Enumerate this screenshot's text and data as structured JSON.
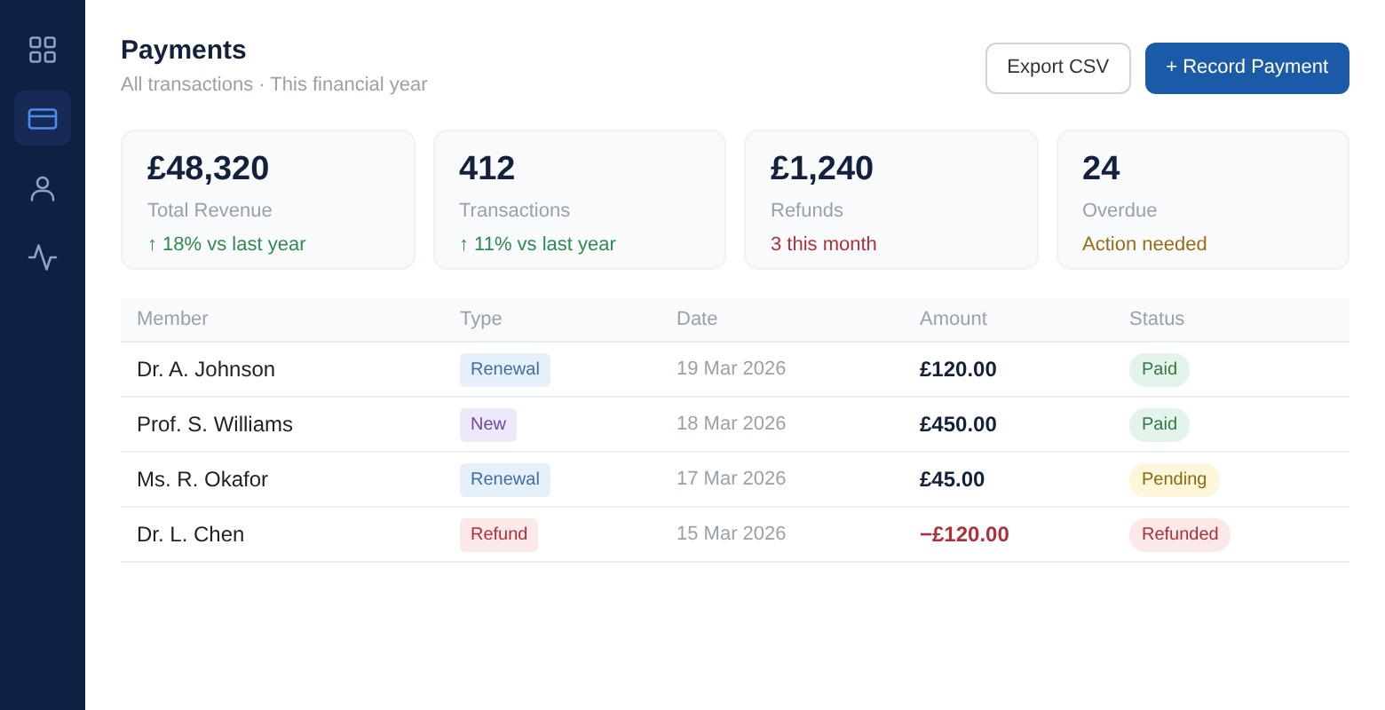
{
  "sidebar": {
    "items": [
      {
        "kind": "grid",
        "selected": false
      },
      {
        "kind": "card",
        "selected": true
      },
      {
        "kind": "user",
        "selected": false
      },
      {
        "kind": "activity",
        "selected": false
      }
    ]
  },
  "header": {
    "title": "Payments",
    "subtitle": "All transactions · This financial year",
    "buttons": [
      {
        "label": "Export CSV",
        "kind": "outline"
      },
      {
        "label": "+ Record Payment",
        "kind": "primary"
      }
    ]
  },
  "stats": [
    {
      "value": "£48,320",
      "label": "Total Revenue",
      "note": "↑ 18% vs last year",
      "kind": "up"
    },
    {
      "value": "412",
      "label": "Transactions",
      "note": "↑ 11% vs last year",
      "kind": "up"
    },
    {
      "value": "£1,240",
      "label": "Refunds",
      "note": "3 this month",
      "kind": "down"
    },
    {
      "value": "24",
      "label": "Overdue",
      "note": "Action needed",
      "kind": "warn"
    }
  ],
  "table": {
    "columns": [
      "Member",
      "Type",
      "Date",
      "Amount",
      "Status"
    ],
    "rows": [
      {
        "member": "Dr. A. Johnson",
        "type": {
          "label": "Renewal",
          "kind": "renewal"
        },
        "date": "19 Mar 2026",
        "amount": {
          "text": "£120.00",
          "kind": "credit"
        },
        "status": {
          "label": "Paid",
          "kind": "paid"
        }
      },
      {
        "member": "Prof. S. Williams",
        "type": {
          "label": "New",
          "kind": "new"
        },
        "date": "18 Mar 2026",
        "amount": {
          "text": "£450.00",
          "kind": "credit"
        },
        "status": {
          "label": "Paid",
          "kind": "paid"
        }
      },
      {
        "member": "Ms. R. Okafor",
        "type": {
          "label": "Renewal",
          "kind": "renewal"
        },
        "date": "17 Mar 2026",
        "amount": {
          "text": "£45.00",
          "kind": "credit"
        },
        "status": {
          "label": "Pending",
          "kind": "pending"
        }
      },
      {
        "member": "Dr. L. Chen",
        "type": {
          "label": "Refund",
          "kind": "refund"
        },
        "date": "15 Mar 2026",
        "amount": {
          "text": "−£120.00",
          "kind": "debit"
        },
        "status": {
          "label": "Refunded",
          "kind": "refunded"
        }
      }
    ]
  }
}
